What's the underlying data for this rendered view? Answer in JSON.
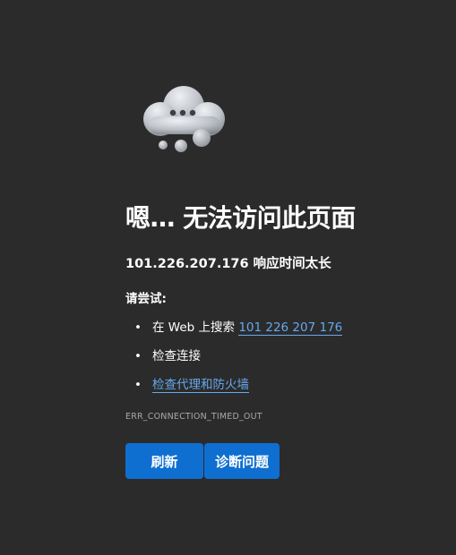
{
  "error_page": {
    "icon": "thought-cloud-icon",
    "title": "嗯… 无法访问此页面",
    "subtitle": "101.226.207.176 响应时间太长",
    "try_label": "请尝试:",
    "suggestions": [
      {
        "bullet": "•",
        "prefix": "在 Web 上搜索 ",
        "link": "101 226 207 176"
      },
      {
        "bullet": "•",
        "text": "检查连接"
      },
      {
        "bullet": "•",
        "link": "检查代理和防火墙"
      }
    ],
    "error_code": "ERR_CONNECTION_TIMED_OUT",
    "buttons": {
      "refresh": "刷新",
      "diagnose": "诊断问题"
    }
  },
  "colors": {
    "background": "#2b2b2b",
    "link": "#66a8ee",
    "button": "#0f6fd1"
  }
}
